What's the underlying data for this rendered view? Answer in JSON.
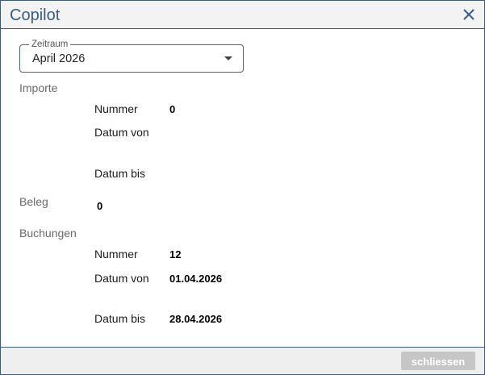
{
  "dialog": {
    "title": "Copilot",
    "close_icon": "close-icon"
  },
  "period": {
    "legend": "Zeitraum",
    "value": "April 2026"
  },
  "importe": {
    "heading": "Importe",
    "nummer_label": "Nummer",
    "nummer_value": "0",
    "datum_von_label": "Datum von",
    "datum_von_value": "",
    "datum_bis_label": "Datum bis",
    "datum_bis_value": ""
  },
  "beleg": {
    "heading": "Beleg",
    "value": "0"
  },
  "buchungen": {
    "heading": "Buchungen",
    "nummer_label": "Nummer",
    "nummer_value": "12",
    "datum_von_label": "Datum von",
    "datum_von_value": "01.04.2026",
    "datum_bis_label": "Datum bis",
    "datum_bis_value": "28.04.2026"
  },
  "footer": {
    "close_label": "schliessen"
  },
  "colors": {
    "accent": "#3a5d82",
    "border": "#3f5a78",
    "button_disabled": "#c6c6c6"
  }
}
